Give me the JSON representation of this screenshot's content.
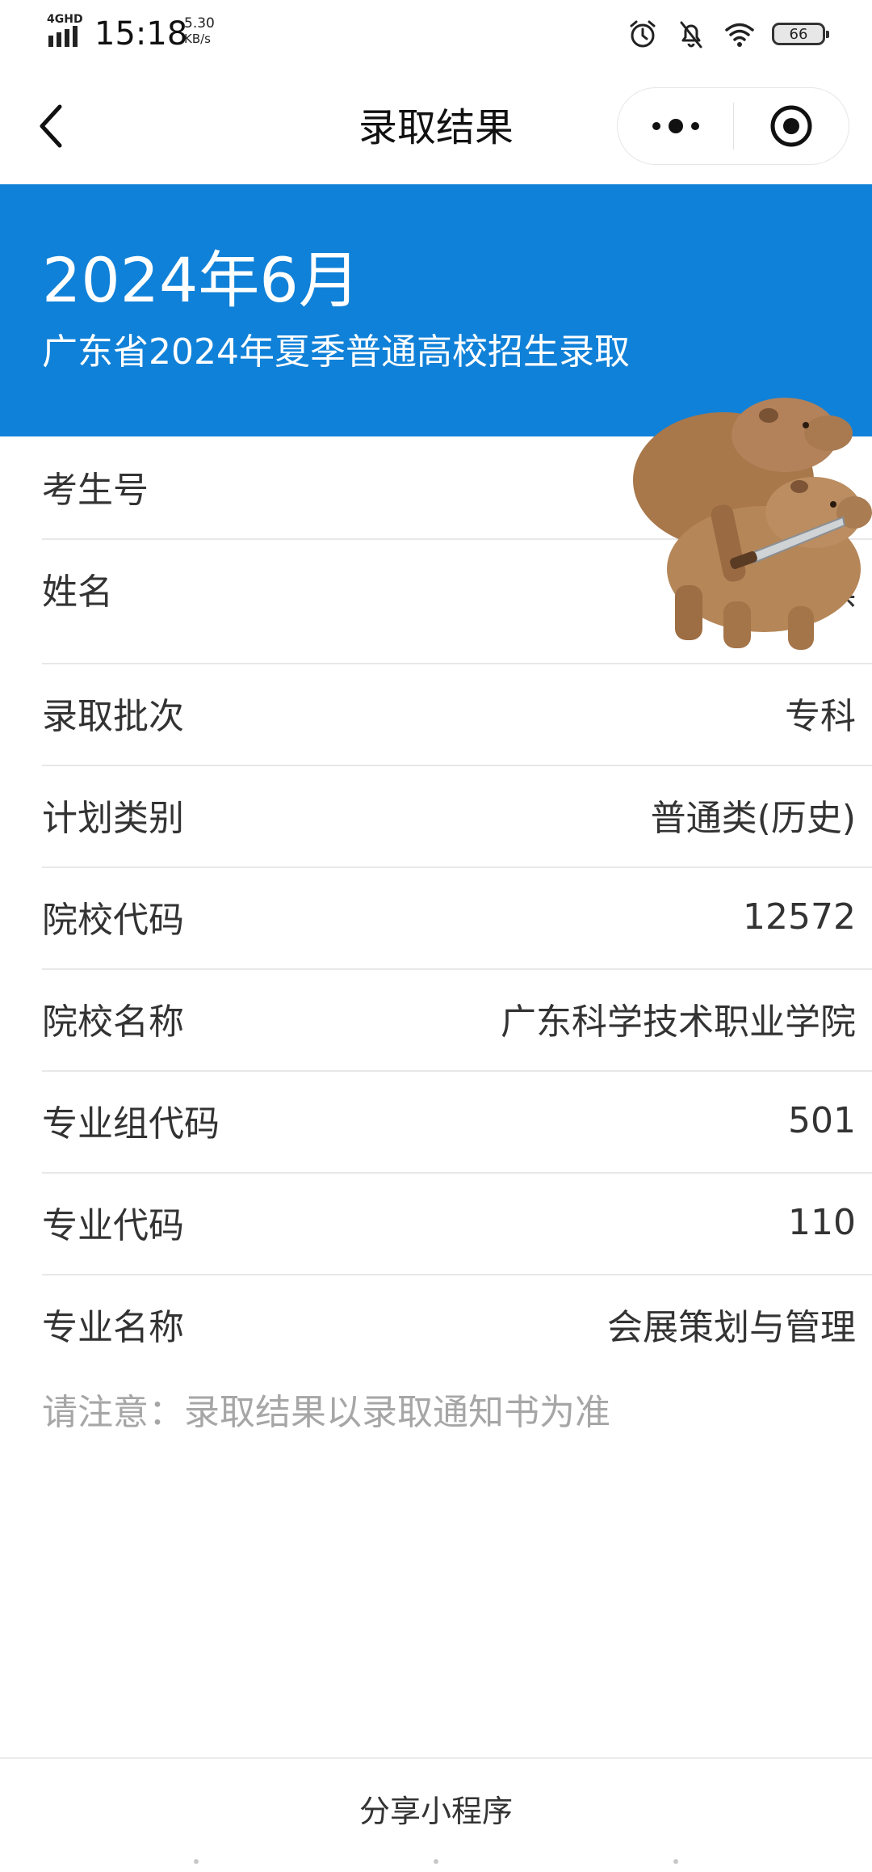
{
  "status_bar": {
    "network": "4GHD",
    "time": "15:18",
    "speed_value": "5.30",
    "speed_unit": "KB/s",
    "battery": "66"
  },
  "nav": {
    "title": "录取结果"
  },
  "banner": {
    "date": "2024年6月",
    "subtitle": "广东省2024年夏季普通高校招生录取"
  },
  "rows": [
    {
      "label": "考生号",
      "value": ""
    },
    {
      "label": "姓名",
      "value": "棋"
    },
    {
      "label": "录取批次",
      "value": "专科"
    },
    {
      "label": "计划类别",
      "value": "普通类(历史)"
    },
    {
      "label": "院校代码",
      "value": "12572"
    },
    {
      "label": "院校名称",
      "value": "广东科学技术职业学院"
    },
    {
      "label": "专业组代码",
      "value": "501"
    },
    {
      "label": "专业代码",
      "value": "110"
    },
    {
      "label": "专业名称",
      "value": "会展策划与管理"
    }
  ],
  "notice": "请注意：录取结果以录取通知书为准",
  "footer": {
    "share_label": "分享小程序"
  },
  "colors": {
    "banner": "#1081d8",
    "notice": "#a6a6a6"
  },
  "icons": [
    "signal-icon",
    "alarm-icon",
    "mute-bell-icon",
    "wifi-icon",
    "battery-icon",
    "back-chevron-icon",
    "more-dots-icon",
    "close-target-icon",
    "capybara-sticker"
  ]
}
